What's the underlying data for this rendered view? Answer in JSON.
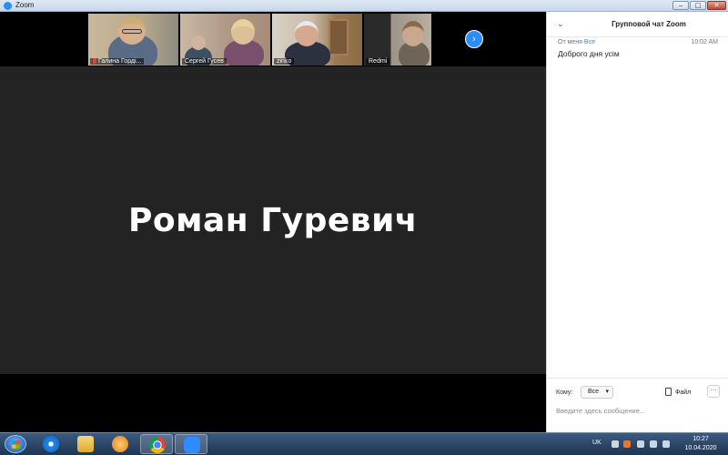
{
  "window": {
    "title": "Zoom",
    "min_glyph": "‒",
    "max_glyph": "□",
    "close_glyph": "✕"
  },
  "participants": [
    {
      "name": "Галина Горді...",
      "muted": true
    },
    {
      "name": "Сергей Гусев",
      "muted": false
    },
    {
      "name": "zinko",
      "muted": false
    },
    {
      "name": "Redmi",
      "muted": false
    }
  ],
  "next_glyph": "›",
  "active_speaker": {
    "name": "Роман Гуревич"
  },
  "chat": {
    "title": "Групповой чат Zoom",
    "collapse_glyph": "⌄",
    "messages": [
      {
        "from": "От меня",
        "to": "Все",
        "time": "10:02 AM",
        "text": "Доброго дня усім"
      }
    ],
    "to_label": "Кому:",
    "recipient": "Все",
    "caret_glyph": "▾",
    "file_label": "Файл",
    "more_glyph": "···",
    "input_placeholder": "Введите здесь сообщение..."
  },
  "taskbar": {
    "lang": "UK",
    "time": "10:27",
    "date": "10.04.2020",
    "apps": [
      "internet-explorer-icon",
      "file-explorer-icon",
      "media-player-icon",
      "chrome-icon",
      "zoom-icon"
    ]
  }
}
